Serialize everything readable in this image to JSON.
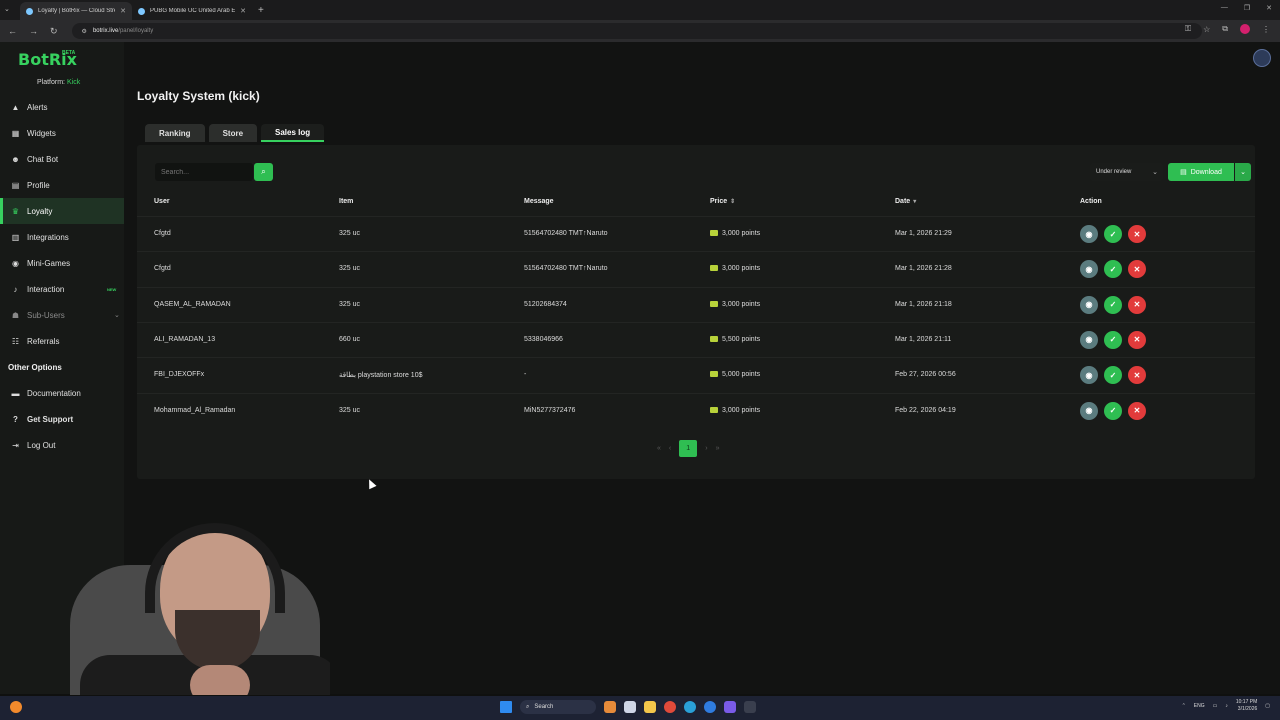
{
  "browser": {
    "tabs": [
      {
        "title": "Loyalty | BotRix — Cloud Strea",
        "active": true
      },
      {
        "title": "PUBG Mobile UC United Arab E",
        "active": false
      }
    ],
    "url_host": "botrix.live",
    "url_path": "/panel/loyalty"
  },
  "sidebar": {
    "logo": "BotRix",
    "beta": "BETA",
    "platform_label": "Platform:",
    "platform_value": "Kick",
    "items": [
      {
        "label": "Alerts",
        "icon": "bell-icon"
      },
      {
        "label": "Widgets",
        "icon": "widgets-icon"
      },
      {
        "label": "Chat Bot",
        "icon": "bot-icon"
      },
      {
        "label": "Profile",
        "icon": "profile-icon"
      },
      {
        "label": "Loyalty",
        "icon": "trophy-icon",
        "active": true
      },
      {
        "label": "Integrations",
        "icon": "puzzle-icon"
      },
      {
        "label": "Mini-Games",
        "icon": "gamepad-icon"
      },
      {
        "label": "Interaction",
        "icon": "music-icon",
        "badge": "NEW"
      },
      {
        "label": "Sub-Users",
        "icon": "users-icon"
      },
      {
        "label": "Referrals",
        "icon": "referrals-icon"
      }
    ],
    "section_title": "Other Options",
    "other": [
      {
        "label": "Documentation",
        "icon": "book-icon"
      },
      {
        "label": "Get Support",
        "icon": "help-icon"
      },
      {
        "label": "Log Out",
        "icon": "logout-icon"
      }
    ]
  },
  "main": {
    "title": "Loyalty System (kick)",
    "tabs": [
      {
        "label": "Ranking"
      },
      {
        "label": "Store"
      },
      {
        "label": "Sales log",
        "active": true
      }
    ],
    "search_placeholder": "Search...",
    "filter_value": "Under review",
    "download_label": "Download",
    "columns": [
      "User",
      "Item",
      "Message",
      "Price",
      "Date",
      "Action"
    ],
    "rows": [
      {
        "user": "Cfgtd",
        "item": "325 uc",
        "message": "51564702480 TMT↑Naruto",
        "price": "3,000 points",
        "date": "Mar 1, 2026 21:29"
      },
      {
        "user": "Cfgtd",
        "item": "325 uc",
        "message": "51564702480 TMT↑Naruto",
        "price": "3,000 points",
        "date": "Mar 1, 2026 21:28"
      },
      {
        "user": "QASEM_AL_RAMADAN",
        "item": "325 uc",
        "message": "51202684374",
        "price": "3,000 points",
        "date": "Mar 1, 2026 21:18"
      },
      {
        "user": "ALI_RAMADAN_13",
        "item": "660 uc",
        "message": "5338046966",
        "price": "5,500 points",
        "date": "Mar 1, 2026 21:11"
      },
      {
        "user": "FBI_DJEXOFFx",
        "item": "بطاقة playstation store 10$",
        "message": "-",
        "price": "5,000 points",
        "date": "Feb 27, 2026 00:56"
      },
      {
        "user": "Mohammad_Al_Ramadan",
        "item": "325 uc",
        "message": "MiN5277372476",
        "price": "3,000 points",
        "date": "Feb 22, 2026 04:19"
      }
    ],
    "pager": {
      "first": "«",
      "prev": "‹",
      "current": "1",
      "next": "›",
      "last": "»"
    }
  },
  "taskbar": {
    "search_label": "Search",
    "lang": "ENG",
    "time": "10:17 PM",
    "date": "3/1/2026"
  },
  "colors": {
    "accent": "#37d15f",
    "danger": "#e23b3b",
    "view": "#5b7c7f"
  }
}
